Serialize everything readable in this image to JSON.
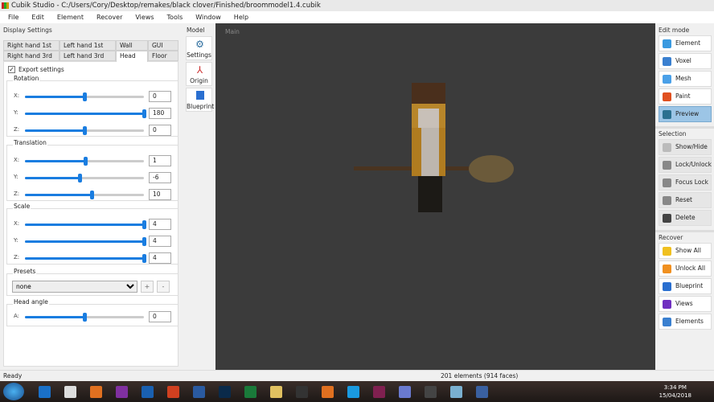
{
  "window": {
    "title": "Cubik Studio - C:/Users/Cory/Desktop/remakes/black clover/Finished/broommodel1.4.cubik"
  },
  "menu": [
    "File",
    "Edit",
    "Element",
    "Recover",
    "Views",
    "Tools",
    "Window",
    "Help"
  ],
  "display_settings": {
    "title": "Display Settings",
    "tabs": [
      "Right hand 1st",
      "Left hand 1st",
      "Wall",
      "GUI",
      "Right hand 3rd",
      "Left hand 3rd",
      "Head",
      "Floor"
    ],
    "active_tab": "Head",
    "export_settings": "Export settings",
    "rotation": {
      "label": "Rotation",
      "x": "0",
      "y": "180",
      "z": "0",
      "fractions": [
        0.5,
        1.0,
        0.5
      ]
    },
    "translation": {
      "label": "Translation",
      "x": "1",
      "y": "-6",
      "z": "10",
      "fractions": [
        0.51,
        0.46,
        0.56
      ]
    },
    "scale": {
      "label": "Scale",
      "x": "4",
      "y": "4",
      "z": "4",
      "fractions": [
        1.0,
        1.0,
        1.0
      ]
    },
    "axes": [
      "X:",
      "Y:",
      "Z:"
    ],
    "presets": {
      "label": "Presets",
      "value": "none",
      "add": "+",
      "remove": "-"
    },
    "head_angle": {
      "label": "Head angle",
      "axis": "A:",
      "value": "0",
      "fraction": 0.5
    }
  },
  "model": {
    "title": "Model",
    "buttons": [
      "Settings",
      "Origin",
      "Blueprint"
    ]
  },
  "viewport": {
    "label": "Main"
  },
  "edit_mode": {
    "title": "Edit mode",
    "buttons": [
      "Element",
      "Voxel",
      "Mesh",
      "Paint",
      "Preview"
    ],
    "active": "Preview"
  },
  "selection": {
    "title": "Selection",
    "buttons": [
      "Show/Hide",
      "Lock/Unlock",
      "Focus Lock",
      "Reset",
      "Delete"
    ]
  },
  "recover": {
    "title": "Recover",
    "buttons": [
      "Show All",
      "Unlock All",
      "Blueprint",
      "Views",
      "Elements"
    ]
  },
  "status": {
    "left": "Ready",
    "right": "201 elements (914 faces)"
  },
  "taskbar": {
    "time": "3:34 PM",
    "date": "15/04/2018",
    "apps": [
      "ie",
      "chrome",
      "media",
      "N",
      "O",
      "P",
      "W",
      "Ps",
      "X",
      "explorer",
      "nox",
      "firefox",
      "S",
      "winrar",
      "discord",
      "cubik",
      "notes",
      "paint"
    ]
  },
  "colors": {
    "accent": "#1a7de0",
    "active_button": "#9cc5e6"
  }
}
